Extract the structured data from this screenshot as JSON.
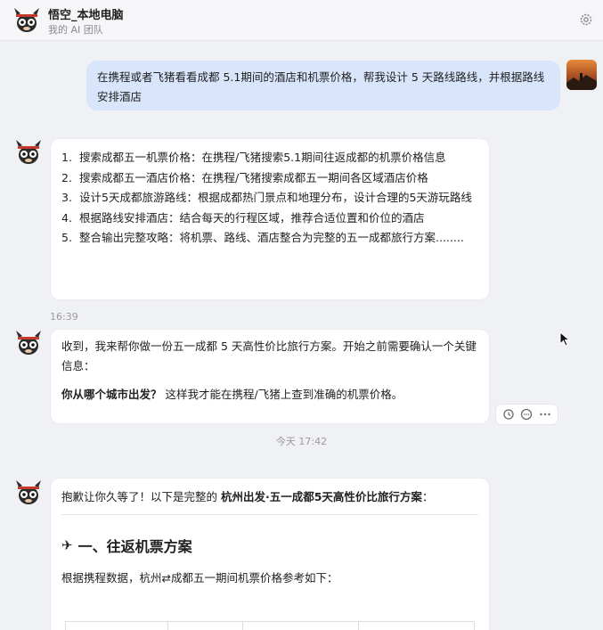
{
  "header": {
    "title": "悟空_本地电脑",
    "subtitle": "我的 AI 团队",
    "icons": [
      "wukong-avatar-icon",
      "gear-icon"
    ]
  },
  "messages": {
    "user_request": "在携程或者飞猪看看成都 5.1期间的酒店和机票价格，帮我设计 5 天路线路线，并根据路线安排酒店",
    "plan": [
      {
        "num": "1.",
        "text": "搜索成都五一机票价格：在携程/飞猪搜索5.1期间往返成都的机票价格信息"
      },
      {
        "num": "2.",
        "text": "搜索成都五一酒店价格：在携程/飞猪搜索成都五一期间各区域酒店价格"
      },
      {
        "num": "3.",
        "text": "设计5天成都旅游路线：根据成都热门景点和地理分布，设计合理的5天游玩路线"
      },
      {
        "num": "4.",
        "text": "根据路线安排酒店：结合每天的行程区域，推荐合适位置和价位的酒店"
      },
      {
        "num": "5.",
        "text": "整合输出完整攻略：将机票、路线、酒店整合为完整的五一成都旅行方案........"
      }
    ],
    "time1": "16:39",
    "reply1": {
      "line1": "收到，我来帮你做一份五一成都 5 天高性价比旅行方案。开始之前需要确认一个关键信息：",
      "question_bold": "你从哪个城市出发？",
      "question_rest": "这样我才能在携程/飞猪上查到准确的机票价格。"
    },
    "time2": "今天 17:42",
    "reply2": {
      "intro_pre": "抱歉让你久等了！以下是完整的 ",
      "intro_bold": "杭州出发·五一成都5天高性价比旅行方案",
      "intro_post": "：",
      "section_icon": "✈",
      "section_title": "一、往返机票方案",
      "paragraph": "根据携程数据，杭州⇄成都五一期间机票价格参考如下："
    }
  },
  "action_icons": [
    "retry-icon",
    "comment-icon",
    "more-icon"
  ],
  "colors": {
    "background": "#f0f1f5",
    "user_bubble": "#d8e5fb",
    "card": "#ffffff"
  }
}
